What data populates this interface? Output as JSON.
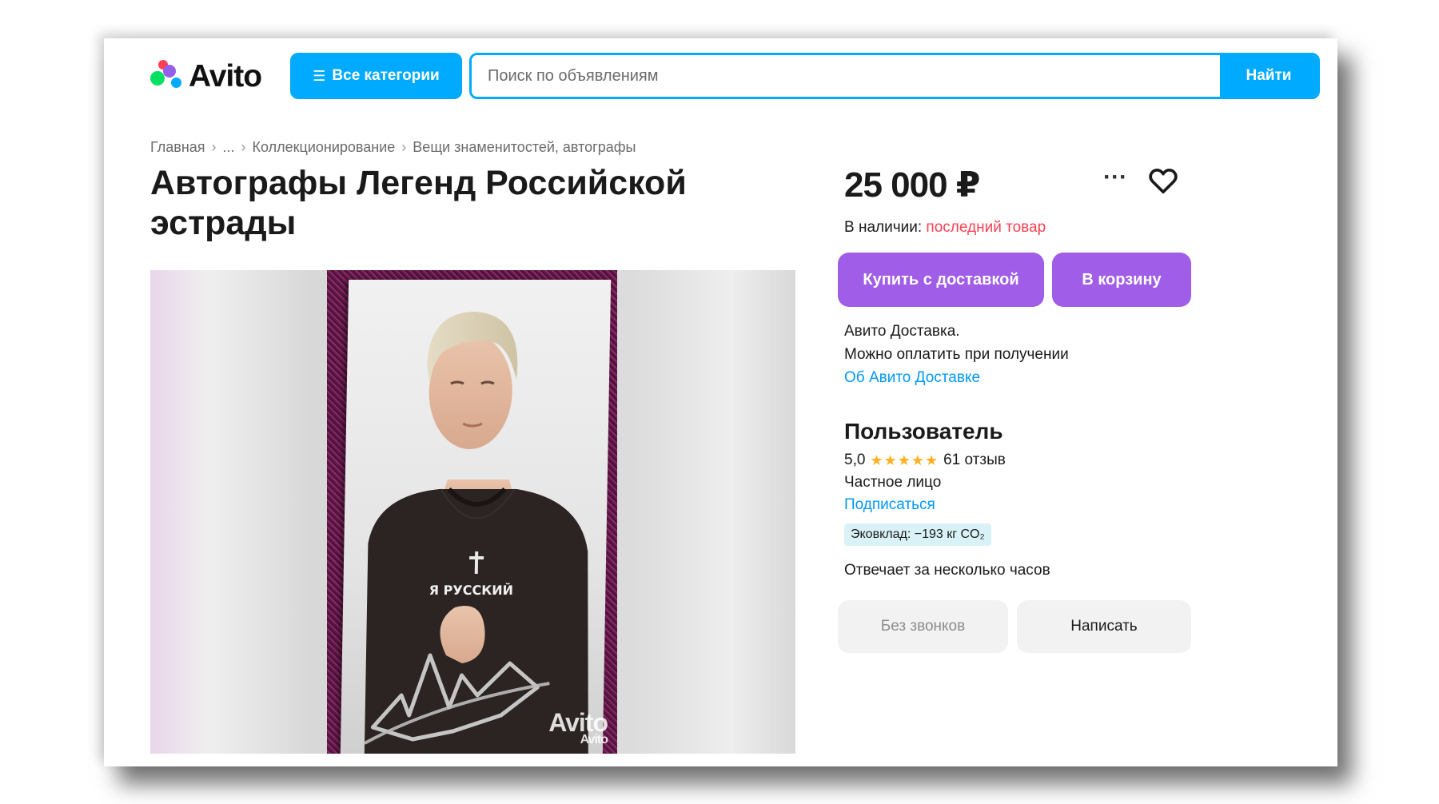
{
  "header": {
    "logo_text": "Avito",
    "categories_label": "Все категории",
    "search_placeholder": "Поиск по объявлениям",
    "search_button": "Найти"
  },
  "breadcrumb": [
    "Главная",
    "...",
    "Коллекционирование",
    "Вещи знаменитостей, автографы"
  ],
  "listing": {
    "title": "Автографы Легенд Российской эстрады",
    "photo": {
      "shirt_text": "Я РУССКИЙ",
      "watermark": "Avito",
      "watermark_small": "Avito"
    },
    "price": "25 000 ₽",
    "stock_label": "В наличии:",
    "stock_value": "последний товар",
    "buy_button": "Купить с доставкой",
    "cart_button": "В корзину",
    "delivery_line1": "Авито Доставка.",
    "delivery_line2": "Можно оплатить при получении",
    "delivery_link": "Об Авито Доставке"
  },
  "seller": {
    "name": "Пользователь",
    "rating": "5,0",
    "stars": 5,
    "reviews": "61 отзыв",
    "type": "Частное лицо",
    "subscribe": "Подписаться",
    "eco": "Эковклад: −193 кг CO₂",
    "responds": "Отвечает за несколько часов",
    "no_calls_button": "Без звонков",
    "write_button": "Написать"
  },
  "colors": {
    "brand_blue": "#00aaff",
    "brand_purple": "#9f5de8",
    "alert_red": "#ff4053",
    "link_blue": "#0099f7",
    "star": "#ffb021"
  }
}
